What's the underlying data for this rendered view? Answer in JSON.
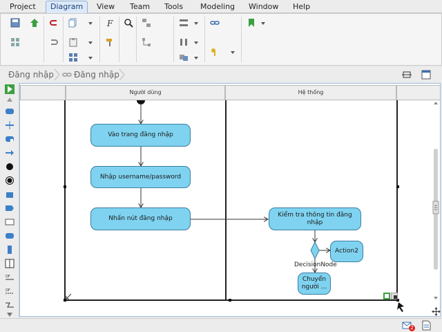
{
  "menubar": {
    "items": [
      "Project",
      "Diagram",
      "View",
      "Team",
      "Tools",
      "Modeling",
      "Window",
      "Help"
    ],
    "active": "Diagram"
  },
  "breadcrumb": {
    "items": [
      "Đăng nhập",
      "Đăng nhập"
    ]
  },
  "diagram": {
    "lanes": [
      "Người dùng",
      "Hệ thống"
    ],
    "nodes": {
      "n1": "Vào trang đăng nhập",
      "n2": "Nhập username/password",
      "n3": "Nhấn nút đăng nhập",
      "n4": "Kiểm tra thông tin đăng nhập",
      "n5": "Action2",
      "n6": "Chuyển người ..."
    },
    "decision_label": "DecisionNode"
  },
  "status": {
    "mail_badge": "2"
  },
  "colors": {
    "action_fill": "#7fd3f0",
    "action_border": "#3a7da0",
    "menu_active": "#dce9f8"
  }
}
